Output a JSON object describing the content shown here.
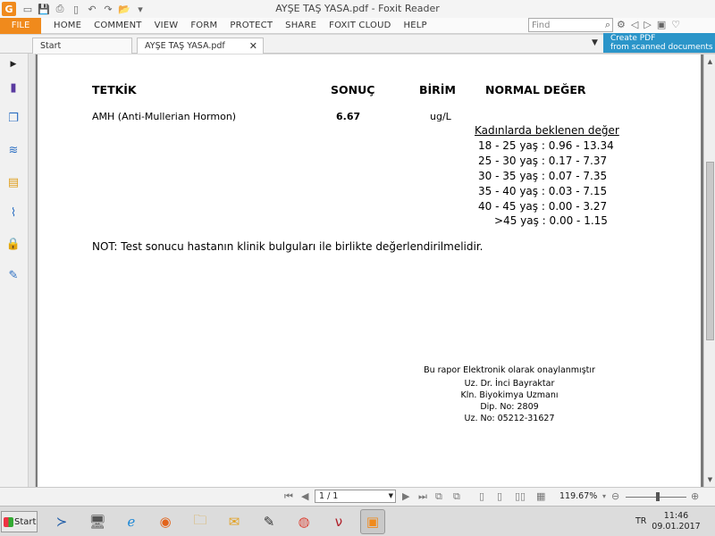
{
  "window": {
    "title": "AYŞE TAŞ YASA.pdf - Foxit Reader",
    "logo": "G"
  },
  "menu": {
    "file": "FILE",
    "items": [
      "HOME",
      "COMMENT",
      "VIEW",
      "FORM",
      "PROTECT",
      "SHARE",
      "FOXIT CLOUD",
      "HELP"
    ]
  },
  "search": {
    "placeholder": "Find"
  },
  "tabs": [
    {
      "label": "Start"
    },
    {
      "label": "AYŞE TAŞ YASA.pdf",
      "close": "✕"
    }
  ],
  "promo": {
    "line1": "Create PDF",
    "line2": "from scanned documents"
  },
  "report": {
    "headers": {
      "test": "TETKİK",
      "result": "SONUÇ",
      "unit": "BİRİM",
      "normal": "NORMAL DEĞER"
    },
    "row": {
      "test": "AMH (Anti-Mullerian Hormon)",
      "result": "6.67",
      "unit": "ug/L"
    },
    "ref_title": "Kadınlarda beklenen değer",
    "ranges": [
      "18 - 25 yaş :  0.96 - 13.34",
      "25 - 30 yaş : 0.17 - 7.37",
      "30 - 35 yaş  : 0.07 - 7.35",
      "35 - 40 yaş  : 0.03 - 7.15",
      "40 - 45 yaş  : 0.00 - 3.27",
      ">45 yaş : 0.00 - 1.15"
    ],
    "note": "NOT: Test sonucu hastanın klinik bulguları ile birlikte değerlendirilmelidir.",
    "signature": [
      "Bu rapor Elektronik olarak onaylanmıştır",
      "Uz. Dr. İnci Bayraktar",
      "Kln. Biyokimya Uzmanı",
      "Dip. No: 2809",
      "Uz. No: 05212-31627"
    ]
  },
  "status": {
    "page": "1 / 1",
    "zoom": "119.67%"
  },
  "taskbar": {
    "start": "Start",
    "lang": "TR",
    "time": "11:46",
    "date": "09.01.2017"
  }
}
